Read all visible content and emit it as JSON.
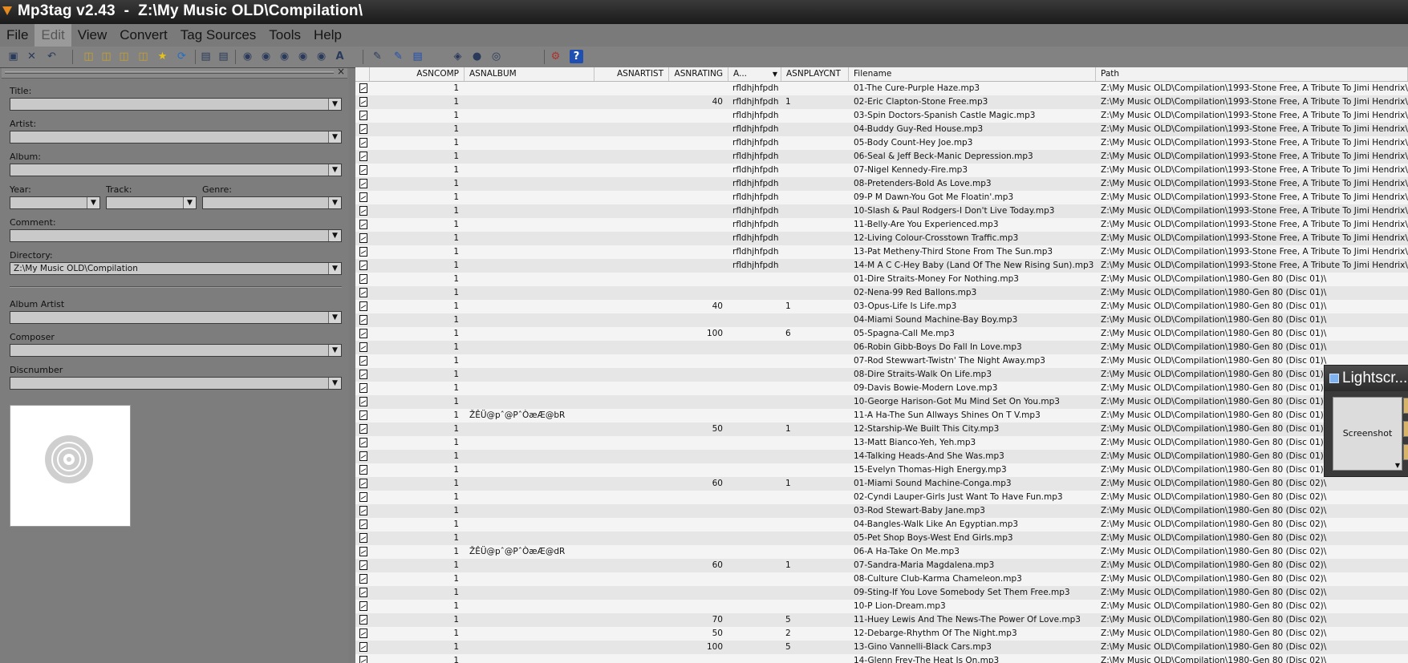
{
  "window": {
    "title": "Mp3tag v2.43  -  Z:\\My Music OLD\\Compilation\\"
  },
  "menu": [
    "File",
    "Edit",
    "View",
    "Convert",
    "Tag Sources",
    "Tools",
    "Help"
  ],
  "toolbar_icons": [
    "save-icon",
    "remove-icon",
    "undo-icon",
    "change-directory-icon",
    "add-directory-icon",
    "add-file-icon",
    "favorite-directory-icon",
    "favorite-star-icon",
    "refresh-icon",
    "copy-tag-icon",
    "paste-tag-icon",
    "tag-filename-icon",
    "filename-tag-icon",
    "text-file-tag-icon",
    "tag-tag-icon",
    "autonumber-icon",
    "case-conversion-icon",
    "extended-tags-icon",
    "export-icon",
    "playlist-icon",
    "freedb-icon",
    "discogs-icon",
    "web-sources-icon",
    "options-icon",
    "help-icon"
  ],
  "tag_panel": {
    "title_label": "Title:",
    "artist_label": "Artist:",
    "album_label": "Album:",
    "year_label": "Year:",
    "track_label": "Track:",
    "genre_label": "Genre:",
    "comment_label": "Comment:",
    "directory_label": "Directory:",
    "directory_value": "Z:\\My Music OLD\\Compilation",
    "album_artist_label": "Album Artist",
    "composer_label": "Composer",
    "discnumber_label": "Discnumber"
  },
  "grid": {
    "columns": [
      "ASNCOMP",
      "ASNALBUM",
      "ASNARTIST",
      "ASNRATING",
      "A...",
      "ASNPLAYCNT",
      "Filename",
      "Path"
    ],
    "rows": [
      {
        "comp": "1",
        "album": "",
        "artist": "",
        "rating": "",
        "a": "rfldhjhfpdh",
        "playcnt": "",
        "filename": "01-The Cure-Purple Haze.mp3",
        "path": "Z:\\My Music OLD\\Compilation\\1993-Stone Free, A Tribute To Jimi Hendrix\\"
      },
      {
        "comp": "1",
        "album": "",
        "artist": "",
        "rating": "40",
        "a": "rfldhjhfpdh",
        "playcnt": "1",
        "filename": "02-Eric Clapton-Stone Free.mp3",
        "path": "Z:\\My Music OLD\\Compilation\\1993-Stone Free, A Tribute To Jimi Hendrix\\"
      },
      {
        "comp": "1",
        "album": "",
        "artist": "",
        "rating": "",
        "a": "rfldhjhfpdh",
        "playcnt": "",
        "filename": "03-Spin Doctors-Spanish Castle Magic.mp3",
        "path": "Z:\\My Music OLD\\Compilation\\1993-Stone Free, A Tribute To Jimi Hendrix\\"
      },
      {
        "comp": "1",
        "album": "",
        "artist": "",
        "rating": "",
        "a": "rfldhjhfpdh",
        "playcnt": "",
        "filename": "04-Buddy Guy-Red House.mp3",
        "path": "Z:\\My Music OLD\\Compilation\\1993-Stone Free, A Tribute To Jimi Hendrix\\"
      },
      {
        "comp": "1",
        "album": "",
        "artist": "",
        "rating": "",
        "a": "rfldhjhfpdh",
        "playcnt": "",
        "filename": "05-Body Count-Hey Joe.mp3",
        "path": "Z:\\My Music OLD\\Compilation\\1993-Stone Free, A Tribute To Jimi Hendrix\\"
      },
      {
        "comp": "1",
        "album": "",
        "artist": "",
        "rating": "",
        "a": "rfldhjhfpdh",
        "playcnt": "",
        "filename": "06-Seal & Jeff Beck-Manic Depression.mp3",
        "path": "Z:\\My Music OLD\\Compilation\\1993-Stone Free, A Tribute To Jimi Hendrix\\"
      },
      {
        "comp": "1",
        "album": "",
        "artist": "",
        "rating": "",
        "a": "rfldhjhfpdh",
        "playcnt": "",
        "filename": "07-Nigel Kennedy-Fire.mp3",
        "path": "Z:\\My Music OLD\\Compilation\\1993-Stone Free, A Tribute To Jimi Hendrix\\"
      },
      {
        "comp": "1",
        "album": "",
        "artist": "",
        "rating": "",
        "a": "rfldhjhfpdh",
        "playcnt": "",
        "filename": "08-Pretenders-Bold As Love.mp3",
        "path": "Z:\\My Music OLD\\Compilation\\1993-Stone Free, A Tribute To Jimi Hendrix\\"
      },
      {
        "comp": "1",
        "album": "",
        "artist": "",
        "rating": "",
        "a": "rfldhjhfpdh",
        "playcnt": "",
        "filename": "09-P M Dawn-You Got Me Floatin'.mp3",
        "path": "Z:\\My Music OLD\\Compilation\\1993-Stone Free, A Tribute To Jimi Hendrix\\"
      },
      {
        "comp": "1",
        "album": "",
        "artist": "",
        "rating": "",
        "a": "rfldhjhfpdh",
        "playcnt": "",
        "filename": "10-Slash & Paul Rodgers-I Don't Live Today.mp3",
        "path": "Z:\\My Music OLD\\Compilation\\1993-Stone Free, A Tribute To Jimi Hendrix\\"
      },
      {
        "comp": "1",
        "album": "",
        "artist": "",
        "rating": "",
        "a": "rfldhjhfpdh",
        "playcnt": "",
        "filename": "11-Belly-Are You Experienced.mp3",
        "path": "Z:\\My Music OLD\\Compilation\\1993-Stone Free, A Tribute To Jimi Hendrix\\"
      },
      {
        "comp": "1",
        "album": "",
        "artist": "",
        "rating": "",
        "a": "rfldhjhfpdh",
        "playcnt": "",
        "filename": "12-Living Colour-Crosstown Traffic.mp3",
        "path": "Z:\\My Music OLD\\Compilation\\1993-Stone Free, A Tribute To Jimi Hendrix\\"
      },
      {
        "comp": "1",
        "album": "",
        "artist": "",
        "rating": "",
        "a": "rfldhjhfpdh",
        "playcnt": "",
        "filename": "13-Pat Metheny-Third Stone From The Sun.mp3",
        "path": "Z:\\My Music OLD\\Compilation\\1993-Stone Free, A Tribute To Jimi Hendrix\\"
      },
      {
        "comp": "1",
        "album": "",
        "artist": "",
        "rating": "",
        "a": "rfldhjhfpdh",
        "playcnt": "",
        "filename": "14-M A C C-Hey Baby (Land Of The New Rising Sun).mp3",
        "path": "Z:\\My Music OLD\\Compilation\\1993-Stone Free, A Tribute To Jimi Hendrix\\"
      },
      {
        "comp": "1",
        "album": "",
        "artist": "",
        "rating": "",
        "a": "",
        "playcnt": "",
        "filename": "01-Dire Straits-Money For Nothing.mp3",
        "path": "Z:\\My Music OLD\\Compilation\\1980-Gen 80 (Disc 01)\\"
      },
      {
        "comp": "1",
        "album": "",
        "artist": "",
        "rating": "",
        "a": "",
        "playcnt": "",
        "filename": "02-Nena-99 Red Ballons.mp3",
        "path": "Z:\\My Music OLD\\Compilation\\1980-Gen 80 (Disc 01)\\"
      },
      {
        "comp": "1",
        "album": "",
        "artist": "",
        "rating": "40",
        "a": "",
        "playcnt": "1",
        "filename": "03-Opus-Life Is Life.mp3",
        "path": "Z:\\My Music OLD\\Compilation\\1980-Gen 80 (Disc 01)\\"
      },
      {
        "comp": "1",
        "album": "",
        "artist": "",
        "rating": "",
        "a": "",
        "playcnt": "",
        "filename": "04-Miami Sound Machine-Bay Boy.mp3",
        "path": "Z:\\My Music OLD\\Compilation\\1980-Gen 80 (Disc 01)\\"
      },
      {
        "comp": "1",
        "album": "",
        "artist": "",
        "rating": "100",
        "a": "",
        "playcnt": "6",
        "filename": "05-Spagna-Call Me.mp3",
        "path": "Z:\\My Music OLD\\Compilation\\1980-Gen 80 (Disc 01)\\"
      },
      {
        "comp": "1",
        "album": "",
        "artist": "",
        "rating": "",
        "a": "",
        "playcnt": "",
        "filename": "06-Robin Gibb-Boys Do Fall In Love.mp3",
        "path": "Z:\\My Music OLD\\Compilation\\1980-Gen 80 (Disc 01)\\"
      },
      {
        "comp": "1",
        "album": "",
        "artist": "",
        "rating": "",
        "a": "",
        "playcnt": "",
        "filename": "07-Rod Stewwart-Twistn' The Night Away.mp3",
        "path": "Z:\\My Music OLD\\Compilation\\1980-Gen 80 (Disc 01)\\"
      },
      {
        "comp": "1",
        "album": "",
        "artist": "",
        "rating": "",
        "a": "",
        "playcnt": "",
        "filename": "08-Dire Straits-Walk On Life.mp3",
        "path": "Z:\\My Music OLD\\Compilation\\1980-Gen 80 (Disc 01)\\"
      },
      {
        "comp": "1",
        "album": "",
        "artist": "",
        "rating": "",
        "a": "",
        "playcnt": "",
        "filename": "09-Davis Bowie-Modern Love.mp3",
        "path": "Z:\\My Music OLD\\Compilation\\1980-Gen 80 (Disc 01)\\"
      },
      {
        "comp": "1",
        "album": "",
        "artist": "",
        "rating": "",
        "a": "",
        "playcnt": "",
        "filename": "10-George Harison-Got Mu Mind Set On You.mp3",
        "path": "Z:\\My Music OLD\\Compilation\\1980-Gen 80 (Disc 01)\\"
      },
      {
        "comp": "1",
        "album": "ŽÊÜ@pˆ@PˆÒæÆ@bR",
        "artist": "",
        "rating": "",
        "a": "",
        "playcnt": "",
        "filename": "11-A Ha-The Sun Allways Shines On T V.mp3",
        "path": "Z:\\My Music OLD\\Compilation\\1980-Gen 80 (Disc 01)\\"
      },
      {
        "comp": "1",
        "album": "",
        "artist": "",
        "rating": "50",
        "a": "",
        "playcnt": "1",
        "filename": "12-Starship-We Built This City.mp3",
        "path": "Z:\\My Music OLD\\Compilation\\1980-Gen 80 (Disc 01)\\"
      },
      {
        "comp": "1",
        "album": "",
        "artist": "",
        "rating": "",
        "a": "",
        "playcnt": "",
        "filename": "13-Matt Bianco-Yeh, Yeh.mp3",
        "path": "Z:\\My Music OLD\\Compilation\\1980-Gen 80 (Disc 01)\\"
      },
      {
        "comp": "1",
        "album": "",
        "artist": "",
        "rating": "",
        "a": "",
        "playcnt": "",
        "filename": "14-Talking Heads-And She Was.mp3",
        "path": "Z:\\My Music OLD\\Compilation\\1980-Gen 80 (Disc 01)\\"
      },
      {
        "comp": "1",
        "album": "",
        "artist": "",
        "rating": "",
        "a": "",
        "playcnt": "",
        "filename": "15-Evelyn Thomas-High Energy.mp3",
        "path": "Z:\\My Music OLD\\Compilation\\1980-Gen 80 (Disc 01)\\"
      },
      {
        "comp": "1",
        "album": "",
        "artist": "",
        "rating": "60",
        "a": "",
        "playcnt": "1",
        "filename": "01-Miami Sound Machine-Conga.mp3",
        "path": "Z:\\My Music OLD\\Compilation\\1980-Gen 80 (Disc 02)\\"
      },
      {
        "comp": "1",
        "album": "",
        "artist": "",
        "rating": "",
        "a": "",
        "playcnt": "",
        "filename": "02-Cyndi Lauper-Girls Just Want To Have Fun.mp3",
        "path": "Z:\\My Music OLD\\Compilation\\1980-Gen 80 (Disc 02)\\"
      },
      {
        "comp": "1",
        "album": "",
        "artist": "",
        "rating": "",
        "a": "",
        "playcnt": "",
        "filename": "03-Rod Stewart-Baby Jane.mp3",
        "path": "Z:\\My Music OLD\\Compilation\\1980-Gen 80 (Disc 02)\\"
      },
      {
        "comp": "1",
        "album": "",
        "artist": "",
        "rating": "",
        "a": "",
        "playcnt": "",
        "filename": "04-Bangles-Walk Like An Egyptian.mp3",
        "path": "Z:\\My Music OLD\\Compilation\\1980-Gen 80 (Disc 02)\\"
      },
      {
        "comp": "1",
        "album": "",
        "artist": "",
        "rating": "",
        "a": "",
        "playcnt": "",
        "filename": "05-Pet Shop Boys-West End Girls.mp3",
        "path": "Z:\\My Music OLD\\Compilation\\1980-Gen 80 (Disc 02)\\"
      },
      {
        "comp": "1",
        "album": "ŽÊÜ@pˆ@PˆÒæÆ@dR",
        "artist": "",
        "rating": "",
        "a": "",
        "playcnt": "",
        "filename": "06-A Ha-Take On Me.mp3",
        "path": "Z:\\My Music OLD\\Compilation\\1980-Gen 80 (Disc 02)\\"
      },
      {
        "comp": "1",
        "album": "",
        "artist": "",
        "rating": "60",
        "a": "",
        "playcnt": "1",
        "filename": "07-Sandra-Maria Magdalena.mp3",
        "path": "Z:\\My Music OLD\\Compilation\\1980-Gen 80 (Disc 02)\\"
      },
      {
        "comp": "1",
        "album": "",
        "artist": "",
        "rating": "",
        "a": "",
        "playcnt": "",
        "filename": "08-Culture Club-Karma Chameleon.mp3",
        "path": "Z:\\My Music OLD\\Compilation\\1980-Gen 80 (Disc 02)\\"
      },
      {
        "comp": "1",
        "album": "",
        "artist": "",
        "rating": "",
        "a": "",
        "playcnt": "",
        "filename": "09-Sting-If You Love Somebody Set Them Free.mp3",
        "path": "Z:\\My Music OLD\\Compilation\\1980-Gen 80 (Disc 02)\\"
      },
      {
        "comp": "1",
        "album": "",
        "artist": "",
        "rating": "",
        "a": "",
        "playcnt": "",
        "filename": "10-P Lion-Dream.mp3",
        "path": "Z:\\My Music OLD\\Compilation\\1980-Gen 80 (Disc 02)\\"
      },
      {
        "comp": "1",
        "album": "",
        "artist": "",
        "rating": "70",
        "a": "",
        "playcnt": "5",
        "filename": "11-Huey Lewis And The News-The Power Of Love.mp3",
        "path": "Z:\\My Music OLD\\Compilation\\1980-Gen 80 (Disc 02)\\"
      },
      {
        "comp": "1",
        "album": "",
        "artist": "",
        "rating": "50",
        "a": "",
        "playcnt": "2",
        "filename": "12-Debarge-Rhythm Of The Night.mp3",
        "path": "Z:\\My Music OLD\\Compilation\\1980-Gen 80 (Disc 02)\\"
      },
      {
        "comp": "1",
        "album": "",
        "artist": "",
        "rating": "100",
        "a": "",
        "playcnt": "5",
        "filename": "13-Gino Vannelli-Black Cars.mp3",
        "path": "Z:\\My Music OLD\\Compilation\\1980-Gen 80 (Disc 02)\\"
      },
      {
        "comp": "1",
        "album": "",
        "artist": "",
        "rating": "",
        "a": "",
        "playcnt": "",
        "filename": "14-Glenn Frey-The Heat Is On.mp3",
        "path": "Z:\\My Music OLD\\Compilation\\1980-Gen 80 (Disc 02)\\"
      }
    ]
  },
  "lightshot": {
    "title": "Lightscr...",
    "button_label": "Screenshot"
  }
}
